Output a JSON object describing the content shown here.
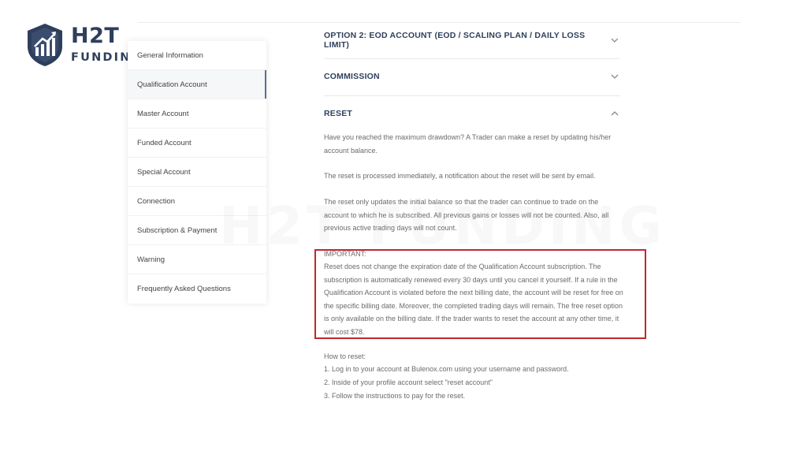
{
  "logo": {
    "brand": "H2T",
    "sub": "FUNDING"
  },
  "sidebar": {
    "items": [
      {
        "label": "General Information"
      },
      {
        "label": "Qualification Account"
      },
      {
        "label": "Master Account"
      },
      {
        "label": "Funded Account"
      },
      {
        "label": "Special Account"
      },
      {
        "label": "Connection"
      },
      {
        "label": "Subscription & Payment"
      },
      {
        "label": "Warning"
      },
      {
        "label": "Frequently Asked Questions"
      }
    ],
    "active_index": 1
  },
  "accordion": {
    "option2": {
      "title": "OPTION 2: EOD ACCOUNT (EOD / SCALING PLAN / DAILY LOSS LIMIT)",
      "state": "collapsed"
    },
    "commission": {
      "title": "COMMISSION",
      "state": "collapsed"
    },
    "reset": {
      "title": "RESET",
      "state": "expanded"
    }
  },
  "reset_content": {
    "p1": "Have you reached the maximum drawdown? A Trader can make a reset by updating his/her account balance.",
    "p2": "The reset is processed immediately, a notification about the reset will be sent by email.",
    "p3": "The reset only updates the initial balance so that the trader can continue to trade on the account to which he is subscribed. All previous gains or losses will not be counted. Also, all previous active trading days will not count.",
    "important_label": "IMPORTANT:",
    "important_text": "Reset does not change the expiration date of the Qualification Account subscription. The subscription is automatically renewed every 30 days until you cancel it yourself. If a rule in the Qualification Account is violated before the next billing date, the account will be reset for free on the specific billing date. Moreover, the completed trading days will remain. The free reset option is only available on the billing date. If the trader wants to reset the account at any other time, it will cost $78.",
    "howto_label": "How to reset:",
    "steps": [
      "1. Log in to your account at Bulenox.com using your username and password.",
      "2. Inside of your profile account select \"reset account\"",
      "3. Follow the instructions to pay for the reset."
    ]
  },
  "watermark": "H2T FUNDING",
  "colors": {
    "brand_navy": "#2e3f5c",
    "highlight_red": "#c0282e",
    "body_text": "#6b6b6b"
  }
}
